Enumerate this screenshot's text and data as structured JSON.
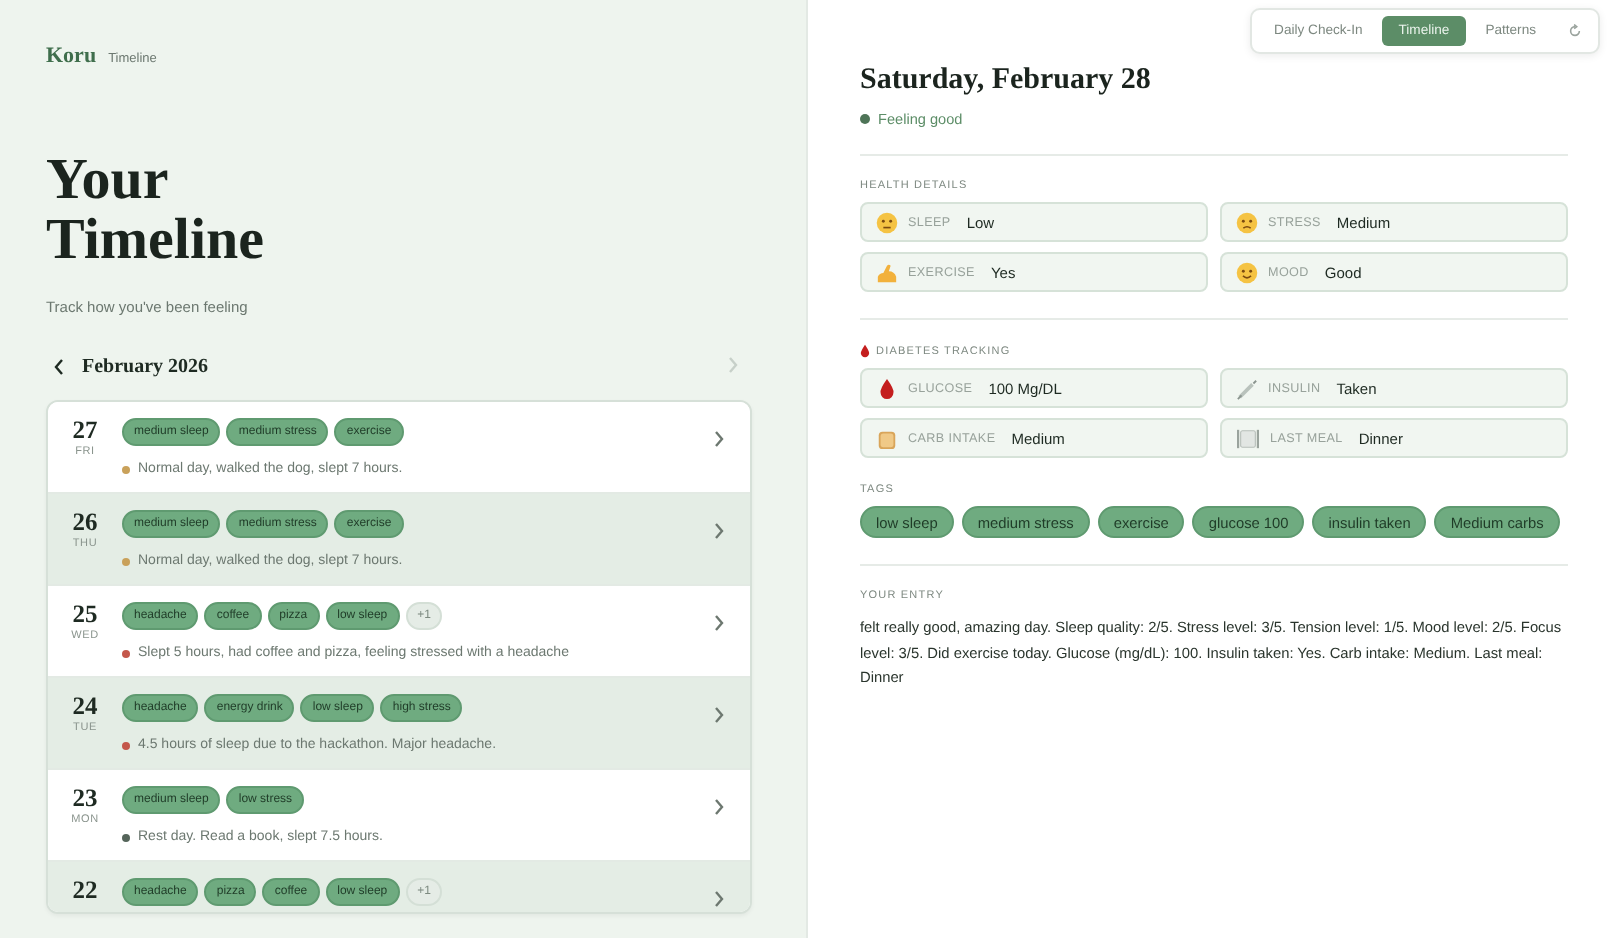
{
  "brand": {
    "logo": "Koru",
    "section": "Timeline"
  },
  "heading": "Your Timeline",
  "subtitle": "Track how you've been feeling",
  "month_nav": {
    "label": "February 2026",
    "next_disabled": true
  },
  "entries": [
    {
      "day": "27",
      "weekday": "FRI",
      "tags": [
        "medium sleep",
        "medium stress",
        "exercise"
      ],
      "note": "Normal day, walked the dog, slept 7 hours.",
      "color": "#c9a15a"
    },
    {
      "day": "26",
      "weekday": "THU",
      "tags": [
        "medium sleep",
        "medium stress",
        "exercise"
      ],
      "note": "Normal day, walked the dog, slept 7 hours.",
      "color": "#c9a15a"
    },
    {
      "day": "25",
      "weekday": "WED",
      "tags": [
        "headache",
        "coffee",
        "pizza",
        "low sleep"
      ],
      "more": "+1",
      "note": "Slept 5 hours, had coffee and pizza, feeling stressed with a headache",
      "color": "#c4574b"
    },
    {
      "day": "24",
      "weekday": "TUE",
      "tags": [
        "headache",
        "energy drink",
        "low sleep",
        "high stress"
      ],
      "note": "4.5 hours of sleep due to the hackathon. Major headache.",
      "color": "#c4574b"
    },
    {
      "day": "23",
      "weekday": "MON",
      "tags": [
        "medium sleep",
        "low stress"
      ],
      "note": "Rest day. Read a book, slept 7.5 hours.",
      "color": "#55655a"
    },
    {
      "day": "22",
      "tags": [
        "headache",
        "pizza",
        "coffee",
        "low sleep"
      ],
      "more": "+1"
    }
  ],
  "tabs": [
    {
      "label": "Daily Check-In",
      "selected": false
    },
    {
      "label": "Timeline",
      "selected": true
    },
    {
      "label": "Patterns",
      "selected": false
    }
  ],
  "detail": {
    "title": "Saturday, February 28",
    "status": "Feeling good",
    "health": {
      "heading": "HEALTH DETAILS",
      "items": [
        {
          "label": "SLEEP",
          "value": "Low"
        },
        {
          "label": "STRESS",
          "value": "Medium"
        },
        {
          "label": "EXERCISE",
          "value": "Yes"
        },
        {
          "label": "MOOD",
          "value": "Good"
        }
      ]
    },
    "diabetes": {
      "heading": "DIABETES TRACKING",
      "items": [
        {
          "label": "GLUCOSE",
          "value": "100 Mg/DL"
        },
        {
          "label": "INSULIN",
          "value": "Taken"
        },
        {
          "label": "CARB INTAKE",
          "value": "Medium"
        },
        {
          "label": "LAST MEAL",
          "value": "Dinner"
        }
      ]
    },
    "tags": {
      "heading": "TAGS",
      "items": [
        "low sleep",
        "medium stress",
        "exercise",
        "glucose 100",
        "insulin taken",
        "Medium carbs"
      ]
    },
    "entry": {
      "heading": "YOUR ENTRY",
      "text": "felt really good, amazing day. Sleep quality: 2/5. Stress level: 3/5. Tension level: 1/5. Mood level: 2/5. Focus level: 3/5. Did exercise today. Glucose (mg/dL): 100. Insulin taken: Yes. Carb intake: Medium. Last meal: Dinner"
    }
  }
}
